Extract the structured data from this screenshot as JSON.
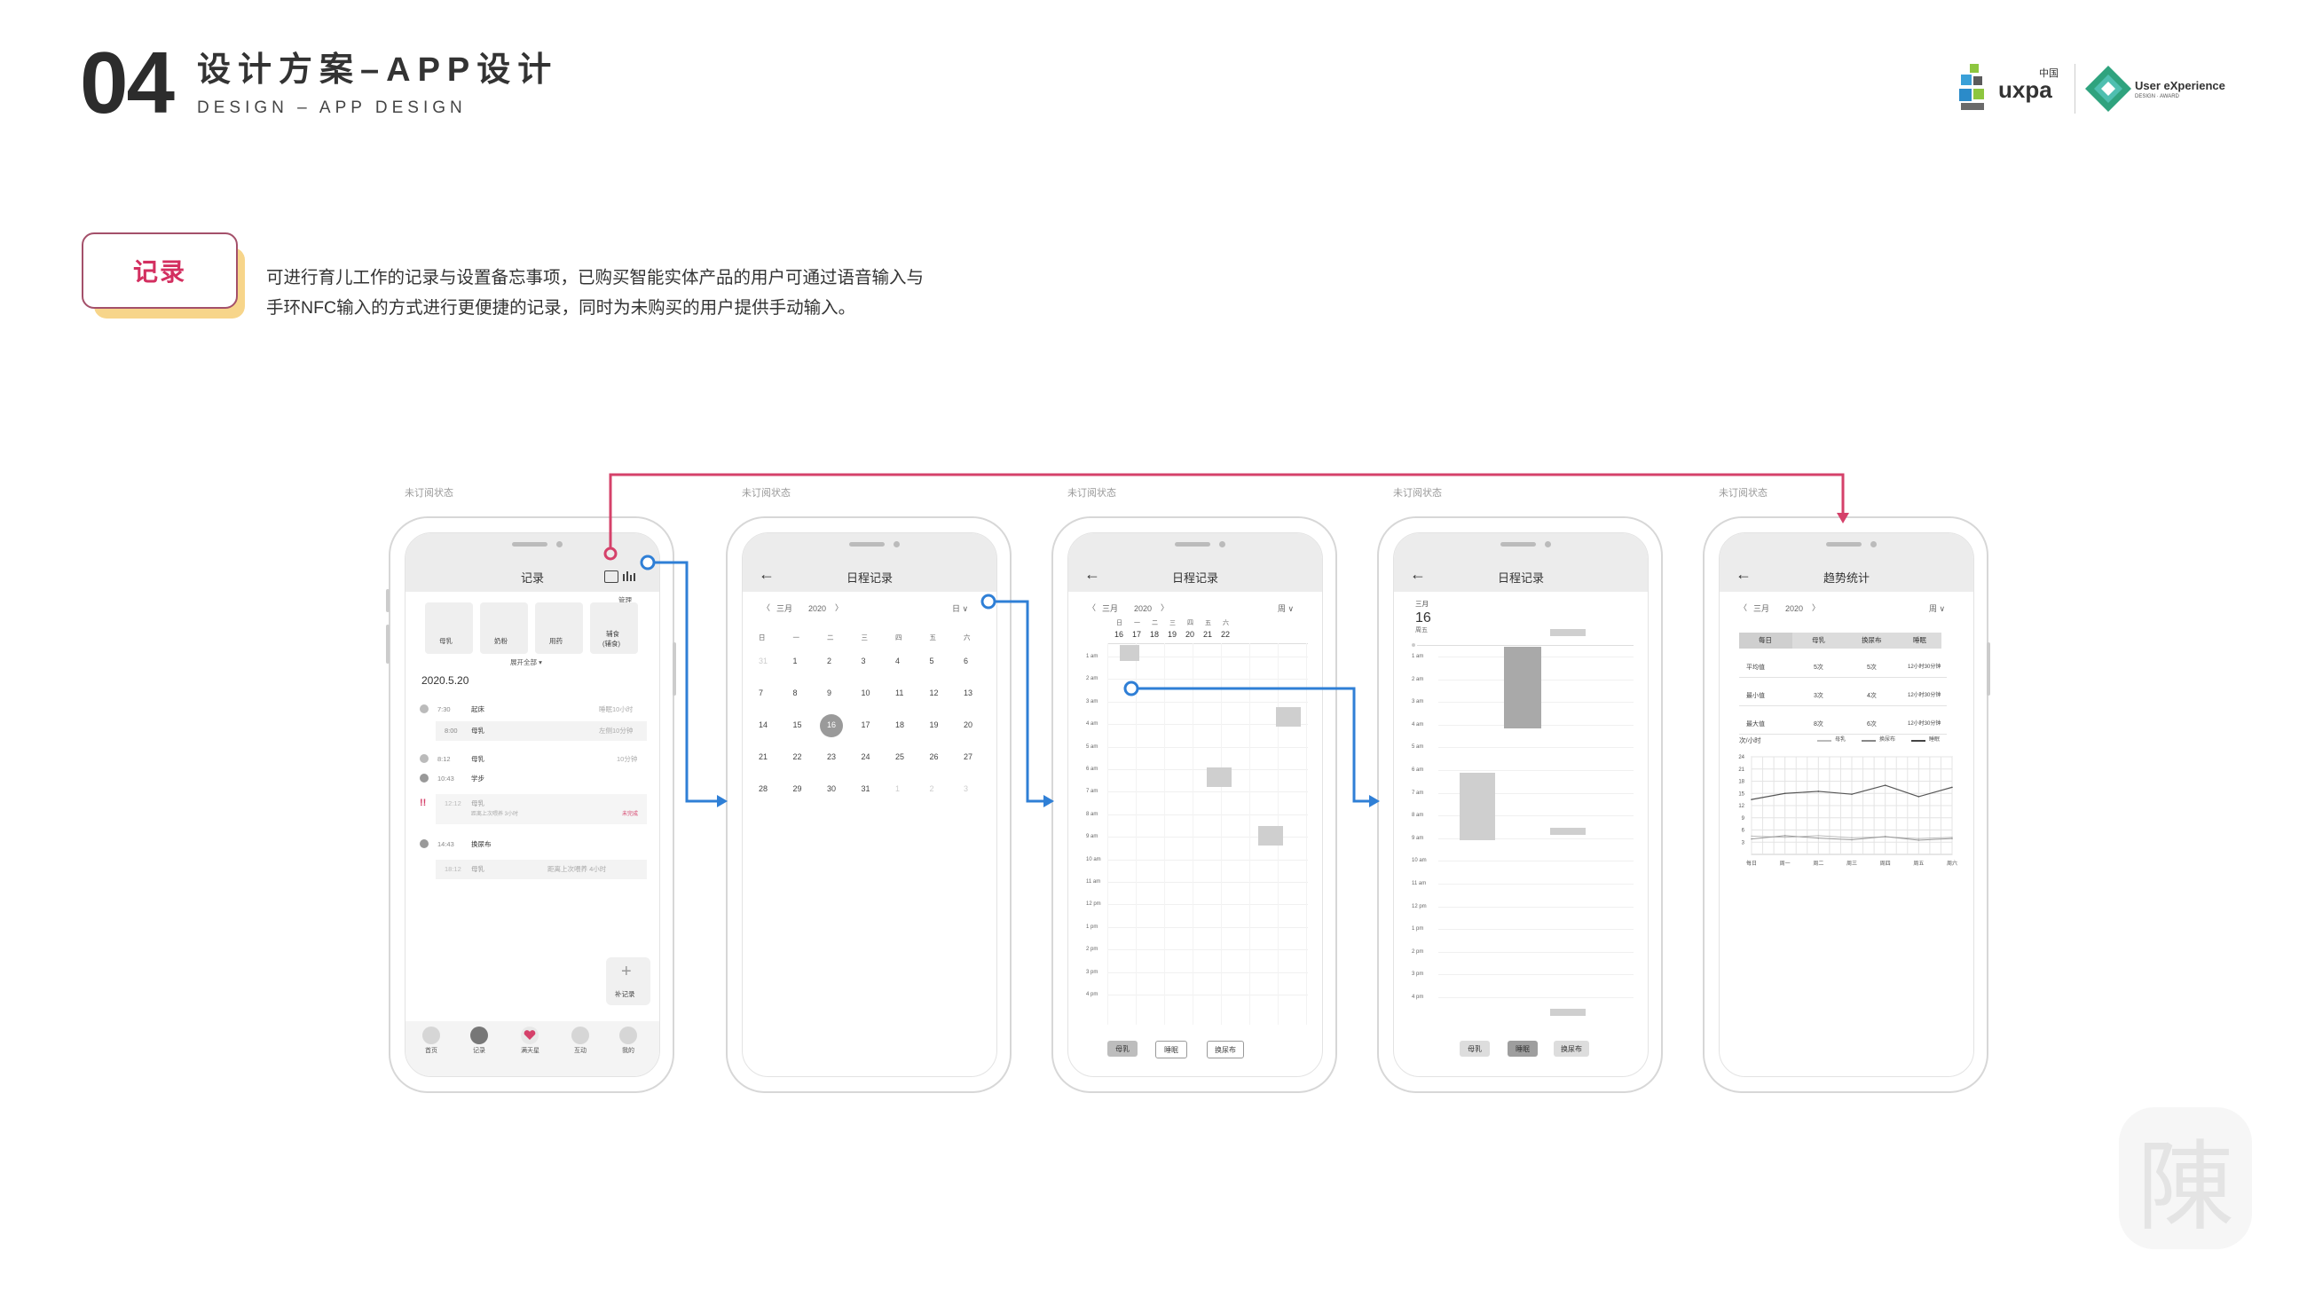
{
  "header": {
    "number": "04",
    "title": "设计方案–APP设计",
    "subtitle": "DESIGN – APP DESIGN"
  },
  "logos": {
    "uxpa": "uxpa",
    "uxpa_cn": "中国",
    "ux_award_line1": "User eXperience",
    "ux_award_line2": "DESIGN · AWARD"
  },
  "section": {
    "tag": "记录",
    "description_line1": "可进行育儿工作的记录与设置备忘事项，已购买智能实体产品的用户可通过语音输入与",
    "description_line2": "手环NFC输入的方式进行更便捷的记录，同时为未购买的用户提供手动输入。"
  },
  "status_label": "未订阅状态",
  "colors": {
    "accent_pink": "#d5416a",
    "connector_blue": "#2f7fd6",
    "tag_shadow": "#f7d58a"
  },
  "screen1": {
    "title": "记录",
    "manage": "管理",
    "quick": [
      "母乳",
      "奶粉",
      "用药",
      "辅食"
    ],
    "quick_food_sub": "(辅食)",
    "expand": "展开全部 ▾",
    "date": "2020.5.20",
    "entries": [
      {
        "time": "7:30",
        "name": "起床",
        "note": "睡眠10小时"
      },
      {
        "time": "8:00",
        "name": "母乳",
        "note": "左侧10分钟"
      },
      {
        "time": "8:12",
        "name": "母乳",
        "note": "10分钟"
      },
      {
        "time": "10:43",
        "name": "学步",
        "note": ""
      },
      {
        "time": "12:12",
        "name": "母乳",
        "note": "距离上次喂养 3小时",
        "warn": "未完成"
      },
      {
        "time": "14:43",
        "name": "换尿布",
        "note": ""
      },
      {
        "time": "18:12",
        "name": "母乳",
        "note": "距离上次喂养 4小时"
      }
    ],
    "warn_mark": "!!",
    "add_label": "补记录",
    "tabs": [
      "首页",
      "记录",
      "满天星",
      "互动",
      "我的"
    ]
  },
  "screen2": {
    "title": "日程记录",
    "month": "三月",
    "year": "2020",
    "mode": "日 ∨",
    "weekdays": [
      "日",
      "一",
      "二",
      "三",
      "四",
      "五",
      "六"
    ],
    "weeks": [
      [
        "31",
        "1",
        "2",
        "3",
        "4",
        "5",
        "6"
      ],
      [
        "7",
        "8",
        "9",
        "10",
        "11",
        "12",
        "13"
      ],
      [
        "14",
        "15",
        "16",
        "17",
        "18",
        "19",
        "20"
      ],
      [
        "21",
        "22",
        "23",
        "24",
        "25",
        "26",
        "27"
      ],
      [
        "28",
        "29",
        "30",
        "31",
        "1",
        "2",
        "3"
      ]
    ],
    "selected": "16"
  },
  "screen3": {
    "title": "日程记录",
    "month": "三月",
    "year": "2020",
    "mode": "周 ∨",
    "weekdays": [
      "日",
      "一",
      "二",
      "三",
      "四",
      "五",
      "六"
    ],
    "dates": [
      "16",
      "17",
      "18",
      "19",
      "20",
      "21",
      "22"
    ],
    "hours": [
      "1 am",
      "2 am",
      "3 am",
      "4 am",
      "5 am",
      "6 am",
      "7 am",
      "8 am",
      "9 am",
      "10 am",
      "11 am",
      "12 pm",
      "1 pm",
      "2 pm",
      "3 pm",
      "4 pm"
    ],
    "filters": [
      "母乳",
      "睡眠",
      "换尿布"
    ]
  },
  "screen4": {
    "title": "日程记录",
    "month": "三月",
    "day": "16",
    "weekday": "周五",
    "hours": [
      "1 am",
      "2 am",
      "3 am",
      "4 am",
      "5 am",
      "6 am",
      "7 am",
      "8 am",
      "9 am",
      "10 am",
      "11 am",
      "12 pm",
      "1 pm",
      "2 pm",
      "3 pm",
      "4 pm"
    ],
    "filters": [
      "母乳",
      "睡眠",
      "换尿布"
    ]
  },
  "screen5": {
    "title": "趋势统计",
    "month": "三月",
    "year": "2020",
    "mode": "周 ∨",
    "tabs": [
      "每日",
      "母乳",
      "换尿布",
      "睡眠"
    ],
    "stats": [
      {
        "label": "平均值",
        "v1": "5次",
        "v2": "5次",
        "v3": "12小时30分钟"
      },
      {
        "label": "最小值",
        "v1": "3次",
        "v2": "4次",
        "v3": "12小时30分钟"
      },
      {
        "label": "最大值",
        "v1": "8次",
        "v2": "6次",
        "v3": "12小时30分钟"
      }
    ],
    "chart_unit": "次/小时",
    "legend": [
      "母乳",
      "换尿布",
      "睡眠"
    ],
    "yticks": [
      "24",
      "21",
      "18",
      "15",
      "12",
      "9",
      "6",
      "3"
    ],
    "xticks": [
      "每日",
      "周一",
      "周二",
      "周三",
      "周四",
      "周五",
      "周六"
    ]
  },
  "chart_data": {
    "type": "line",
    "categories": [
      "每日",
      "周一",
      "周二",
      "周三",
      "周四",
      "周五",
      "周六"
    ],
    "ylabel": "次/小时",
    "ylim": [
      0,
      24
    ],
    "series": [
      {
        "name": "母乳",
        "values": [
          4.5,
          4.2,
          4.6,
          4.1,
          4.3,
          3.9,
          4.2
        ]
      },
      {
        "name": "换尿布",
        "values": [
          3.8,
          4.6,
          4.0,
          3.6,
          4.4,
          3.5,
          3.9
        ]
      },
      {
        "name": "睡眠",
        "values": [
          13.5,
          15.0,
          15.5,
          14.8,
          17.0,
          14.2,
          16.5
        ]
      }
    ],
    "grid": true,
    "legend": "top-right"
  },
  "watermark": "陳"
}
